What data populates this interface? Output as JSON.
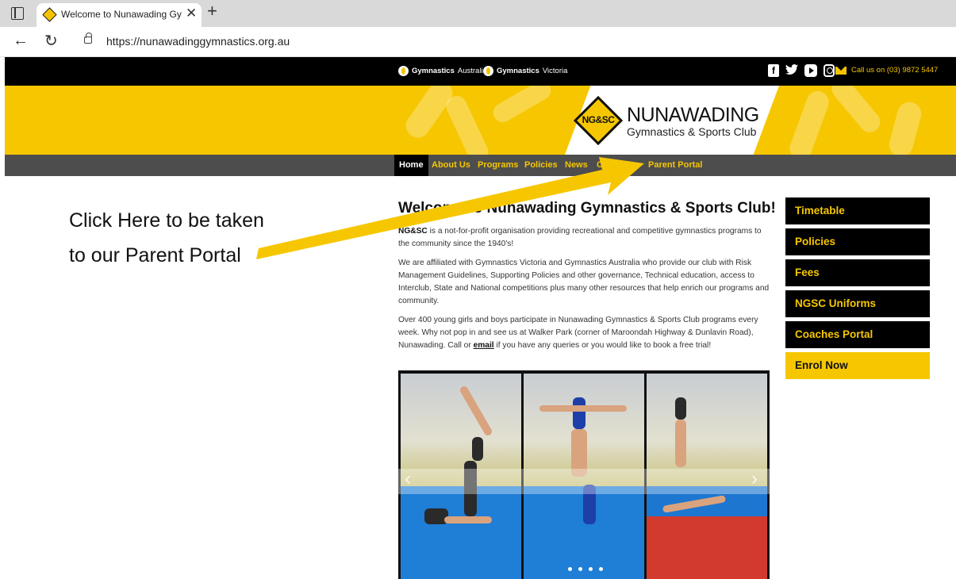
{
  "browser": {
    "tab_title": "Welcome to Nunawading Gymnastics",
    "tab_close": "✕",
    "new_tab": "+",
    "url": "https://nunawadinggymnastics.org.au",
    "icons": [
      "window-icon",
      "favicon",
      "back-icon",
      "reload-icon",
      "lock-icon"
    ]
  },
  "topbar": {
    "affiliations": [
      {
        "bold": "Gymnastics",
        "rest": "Australia"
      },
      {
        "bold": "Gymnastics",
        "rest": "Victoria"
      }
    ],
    "social_icons": [
      "facebook-icon",
      "twitter-icon",
      "youtube-icon",
      "instagram-icon"
    ],
    "facebook_glyph": "f",
    "twitter_glyph": "🐦",
    "call_text": "Call us on (03) 9872 5447"
  },
  "banner": {
    "logo_mark": "NG&SC",
    "logo_name": "NUNAWADING",
    "logo_sub": "Gymnastics & Sports Club"
  },
  "nav": {
    "items": [
      "Home",
      "About Us",
      "Programs",
      "Policies",
      "News",
      "C",
      "Parent Portal"
    ],
    "active": "Home"
  },
  "annotation": {
    "text": "Click Here to be taken to our Parent Portal",
    "arrow_color": "#f6c700"
  },
  "content": {
    "heading": "Welcome to Nunawading Gymnastics & Sports Club!",
    "p1_bold": "NG&SC",
    "p1_rest": " is a not-for-profit organisation providing recreational and competitive gymnastics programs to the community since the 1940's!",
    "p2": "We are affiliated with Gymnastics Victoria and Gymnastics Australia who provide our club with Risk Management Guidelines, Supporting Policies and other governance, Technical education, access to Interclub, State and National competitions plus many other resources that help enrich our programs and community.",
    "p3_a": "Over 400 young girls and boys participate in Nunawading Gymnastics & Sports Club programs every week. Why not pop in and see us at Walker Park (corner of Maroondah Highway & Dunlavin Road), Nunawading. Call or ",
    "p3_link": "email",
    "p3_b": " if you have any queries or you would like to book a free trial!"
  },
  "carousel": {
    "prev": "‹",
    "next": "›"
  },
  "sidebar": {
    "buttons": [
      "Timetable",
      "Policies",
      "Fees",
      "NGSC Uniforms",
      "Coaches Portal",
      "Enrol Now"
    ]
  },
  "colors": {
    "brand_yellow": "#f6c700",
    "nav_grey": "#4d4d4d",
    "black": "#000000"
  }
}
